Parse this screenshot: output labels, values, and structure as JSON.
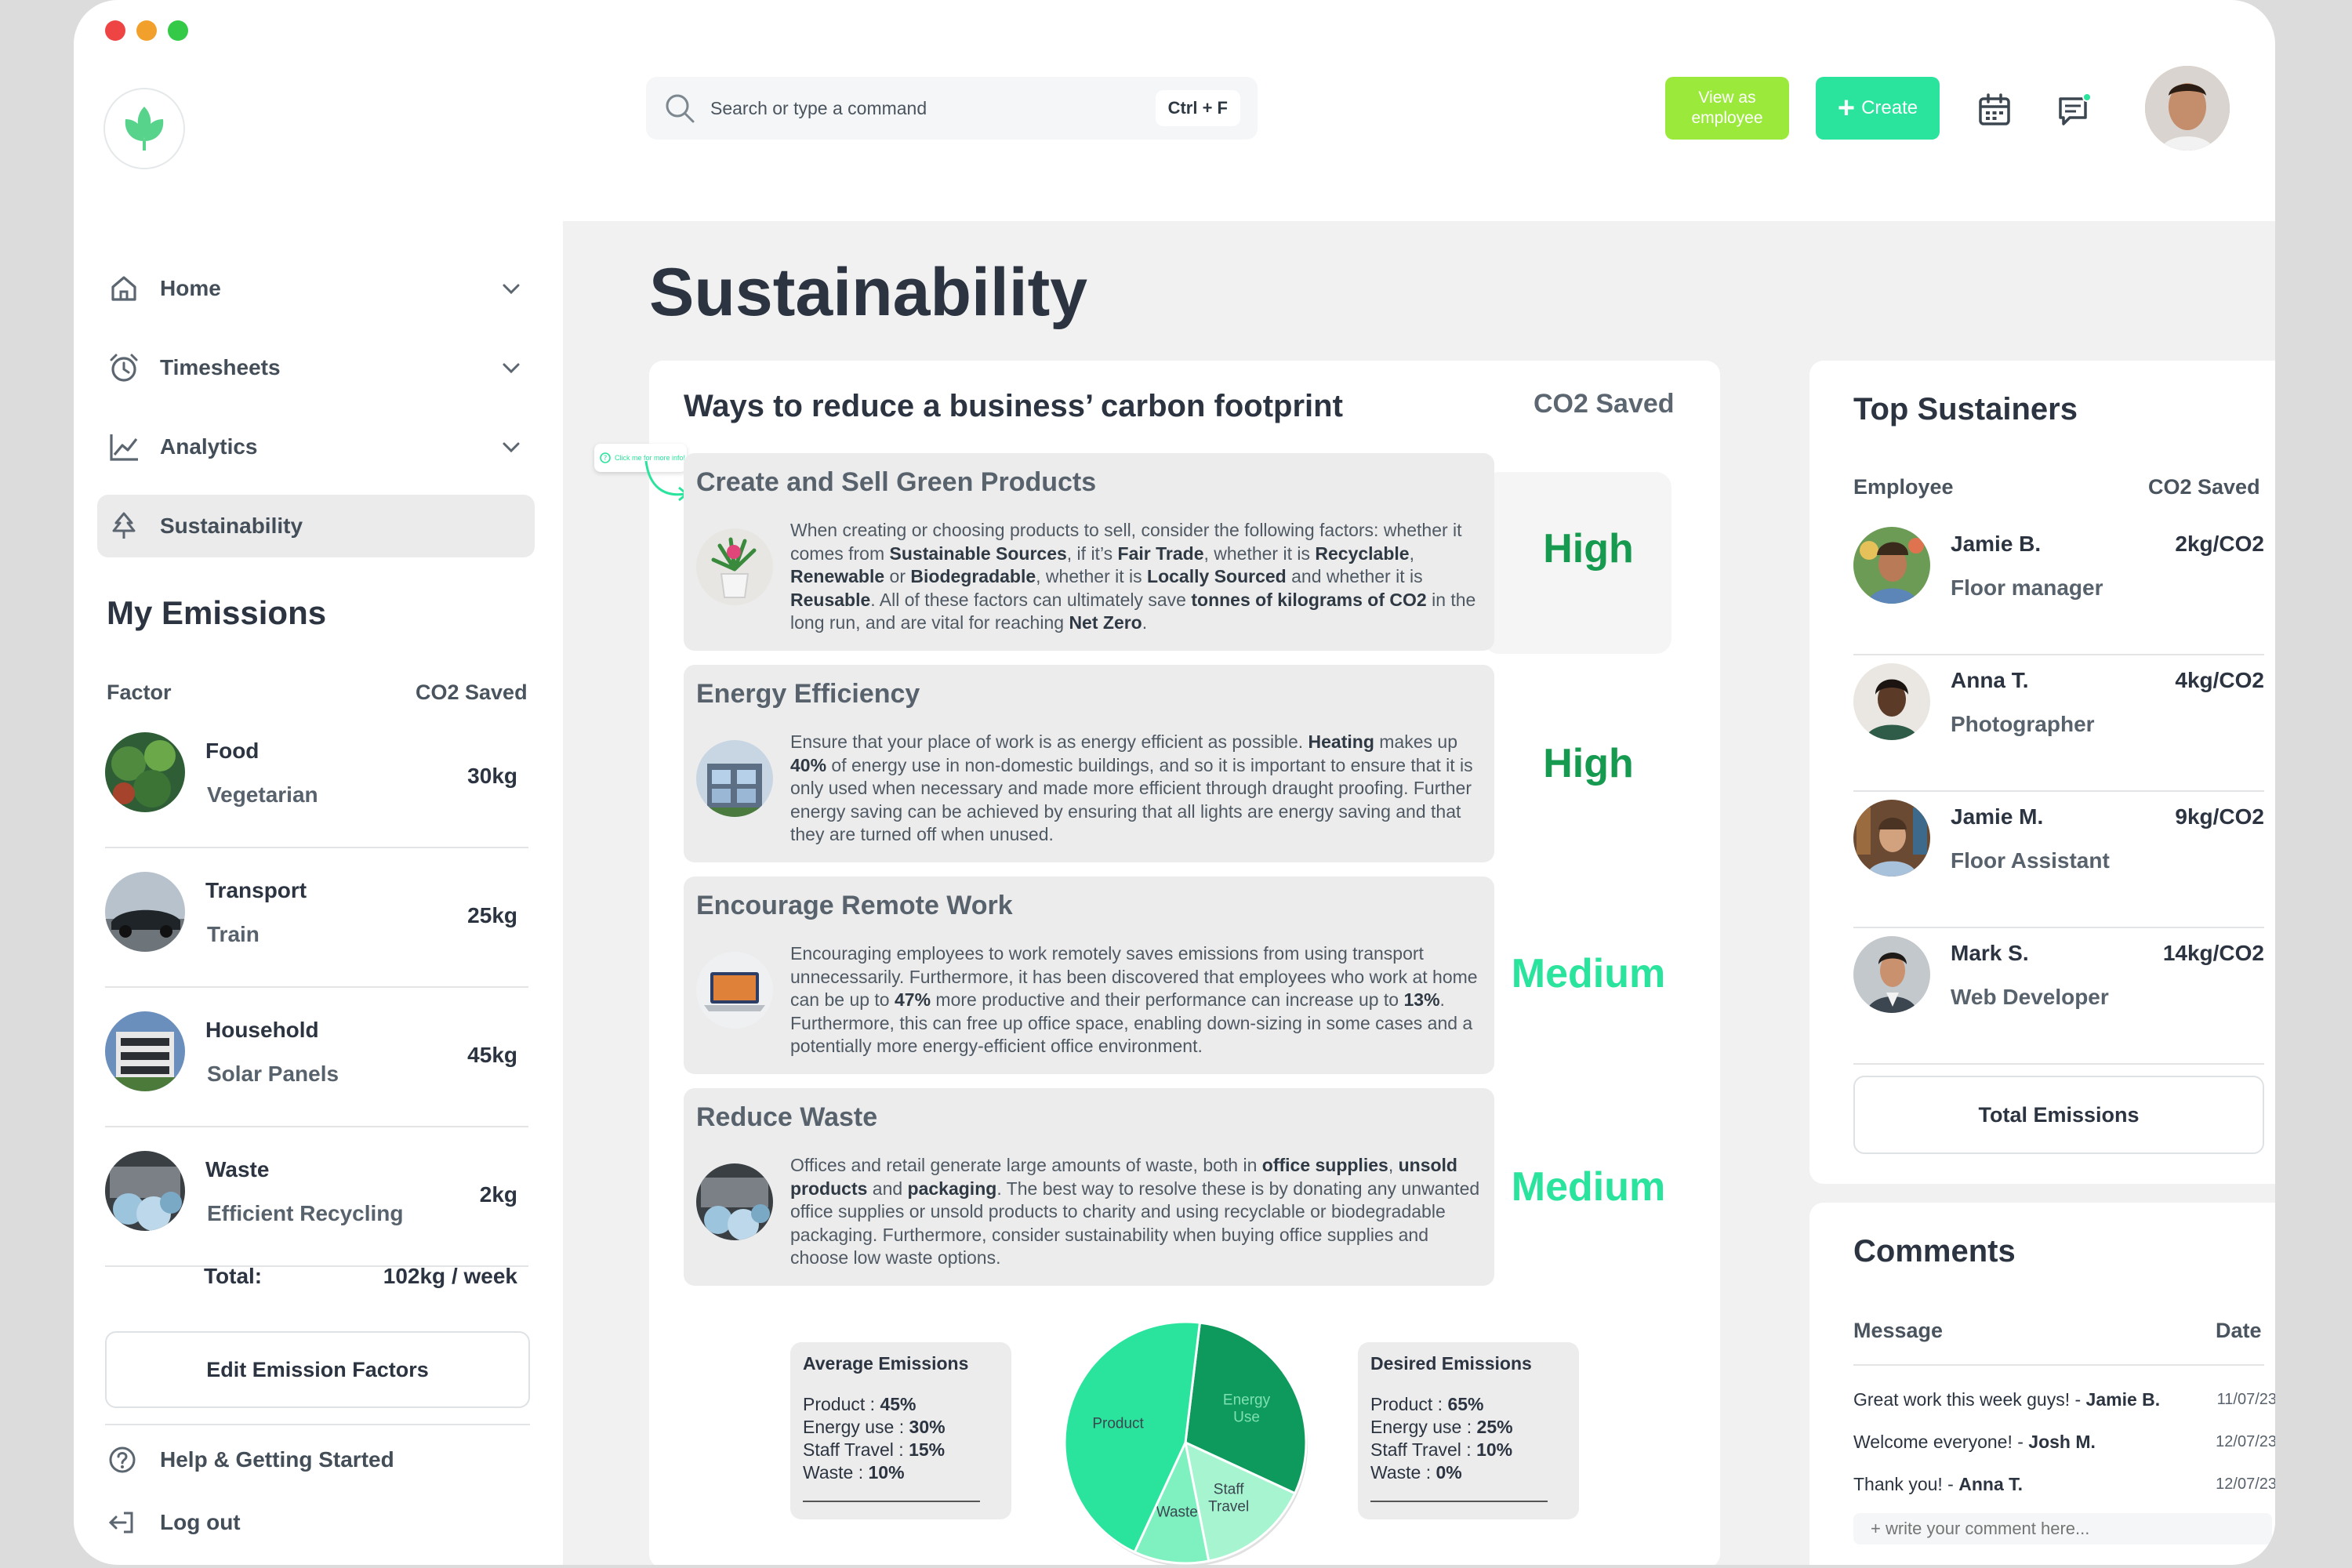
{
  "colors": {
    "brand": "#2ae39c",
    "view_btn": "#9bea3b",
    "high": "#159a4f",
    "medium": "#2ae39c"
  },
  "header": {
    "search_placeholder": "Search or type a command",
    "search_shortcut": "Ctrl + F",
    "view_as_employee_label": "View as employee",
    "create_label": "Create"
  },
  "sidebar": {
    "items": [
      {
        "label": "Home",
        "icon": "home-icon"
      },
      {
        "label": "Timesheets",
        "icon": "clock-icon"
      },
      {
        "label": "Analytics",
        "icon": "chart-line-icon"
      },
      {
        "label": "Sustainability",
        "icon": "tree-icon"
      }
    ],
    "emissions_title": "My Emissions",
    "col_factor": "Factor",
    "col_co2": "CO2 Saved",
    "emissions": [
      {
        "name": "Food",
        "sub": "Vegetarian",
        "value": "30kg"
      },
      {
        "name": "Transport",
        "sub": "Train",
        "value": "25kg"
      },
      {
        "name": "Household",
        "sub": "Solar Panels",
        "value": "45kg"
      },
      {
        "name": "Waste",
        "sub": "Efficient Recycling",
        "value": "2kg"
      }
    ],
    "total_label": "Total:",
    "total_value": "102kg / week",
    "edit_button": "Edit Emission Factors",
    "help_label": "Help & Getting Started",
    "logout_label": "Log out"
  },
  "main": {
    "page_title": "Sustainability",
    "ways": {
      "title": "Ways to reduce a business’ carbon footprint",
      "co2_header": "CO2 Saved",
      "tip": "Click me for more info!",
      "cards": [
        {
          "title": "Create and Sell Green Products",
          "impact": "High"
        },
        {
          "title": "Energy Efficiency",
          "impact": "High"
        },
        {
          "title": "Encourage Remote Work",
          "impact": "Medium"
        },
        {
          "title": "Reduce Waste",
          "impact": "Medium"
        }
      ]
    },
    "average": {
      "title": "Average Emissions",
      "lines": [
        {
          "k": "Product : ",
          "v": "45%"
        },
        {
          "k": "Energy use : ",
          "v": "30%"
        },
        {
          "k": "Staff Travel : ",
          "v": "15%"
        },
        {
          "k": "Waste : ",
          "v": "10%"
        }
      ]
    },
    "desired": {
      "title": "Desired Emissions",
      "lines": [
        {
          "k": "Product : ",
          "v": "65%"
        },
        {
          "k": "Energy use : ",
          "v": "25%"
        },
        {
          "k": "Staff Travel : ",
          "v": "10%"
        },
        {
          "k": "Waste : ",
          "v": "0%"
        }
      ]
    },
    "pie": {
      "slices": [
        {
          "label": "Energy Use",
          "value": 30,
          "color": "#0e9a5c"
        },
        {
          "label": "Staff Travel",
          "value": 15,
          "color": "#a6f5d0"
        },
        {
          "label": "Waste",
          "value": 10,
          "color": "#7ff0c0"
        },
        {
          "label": "Product",
          "value": 45,
          "color": "#2ae39c"
        }
      ]
    }
  },
  "top_sustainers": {
    "title": "Top Sustainers",
    "col_employee": "Employee",
    "col_co2": "CO2 Saved",
    "rows": [
      {
        "name": "Jamie B.",
        "role": "Floor manager",
        "value": "2kg/CO2"
      },
      {
        "name": "Anna T.",
        "role": "Photographer",
        "value": "4kg/CO2"
      },
      {
        "name": "Jamie M.",
        "role": "Floor Assistant",
        "value": "9kg/CO2"
      },
      {
        "name": "Mark S.",
        "role": "Web Developer",
        "value": "14kg/CO2"
      }
    ],
    "total_button": "Total Emissions"
  },
  "comments": {
    "title": "Comments",
    "col_message": "Message",
    "col_date": "Date",
    "rows": [
      {
        "msg": "Great work this week guys! - ",
        "author": "Jamie B.",
        "date": "11/07/23"
      },
      {
        "msg": "Welcome everyone! - ",
        "author": "Josh M.",
        "date": "12/07/23"
      },
      {
        "msg": "Thank you! - ",
        "author": "Anna T.",
        "date": "12/07/23"
      }
    ],
    "input_placeholder": "+ write your comment here..."
  }
}
